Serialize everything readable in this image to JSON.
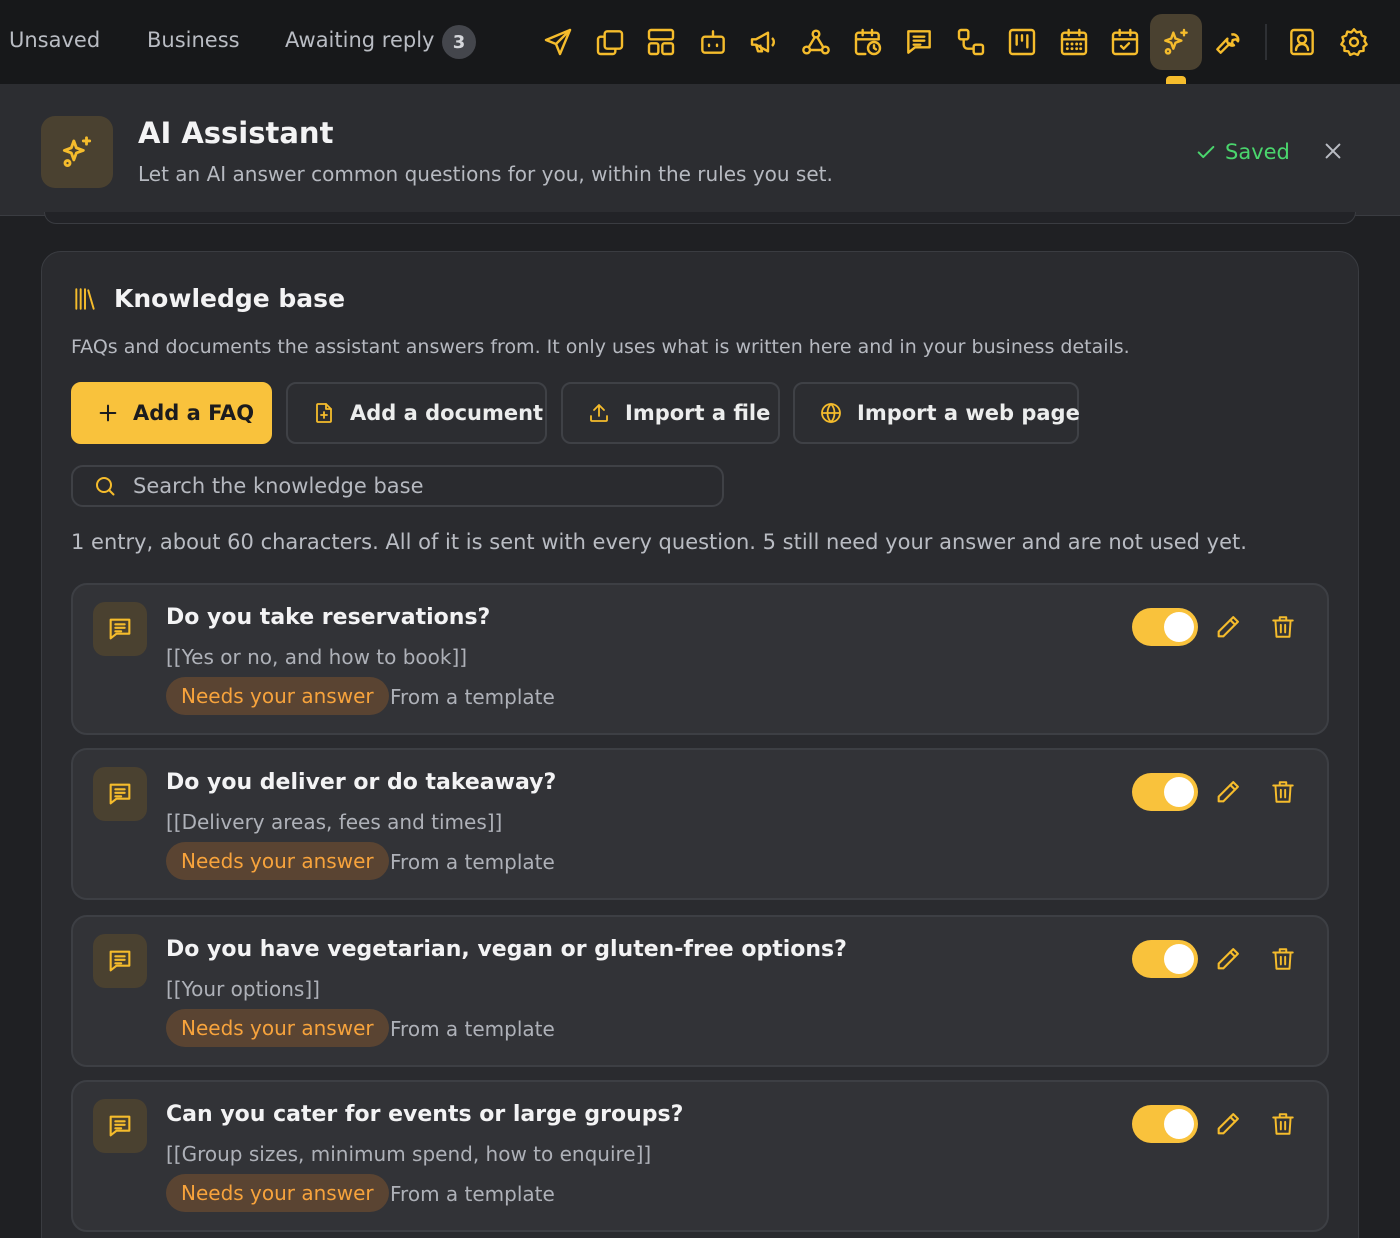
{
  "topbar": {
    "tabs": [
      "Unsaved",
      "Business",
      "Awaiting reply"
    ],
    "awaiting_count": "3",
    "icons": [
      "send-icon",
      "copy-icon",
      "layout-icon",
      "bot-icon",
      "megaphone-icon",
      "webhook-icon",
      "calendar-clock-icon",
      "message-icon",
      "workflow-icon",
      "kanban-icon",
      "calendar-grid-icon",
      "calendar-check-icon",
      "sparkles-icon",
      "wrench-icon",
      "contact-icon",
      "gear-icon"
    ],
    "active_icon": "sparkles-icon"
  },
  "header": {
    "title": "AI Assistant",
    "subtitle": "Let an AI answer common questions for you, within the rules you set.",
    "saved_label": "Saved"
  },
  "knowledge_base": {
    "title": "Knowledge base",
    "description": "FAQs and documents the assistant answers from. It only uses what is written here and in your business details.",
    "buttons": {
      "add_faq": "Add a FAQ",
      "add_document": "Add a document",
      "import_file": "Import a file",
      "import_web": "Import a web page"
    },
    "search_placeholder": "Search the knowledge base",
    "summary": "1 entry, about 60 characters. All of it is sent with every question. 5 still need your answer and are not used yet.",
    "entries": [
      {
        "question": "Do you take reservations?",
        "answer": "[[Yes or no, and how to book]]",
        "status": "Needs your answer",
        "source": "From a template",
        "enabled": true
      },
      {
        "question": "Do you deliver or do takeaway?",
        "answer": "[[Delivery areas, fees and times]]",
        "status": "Needs your answer",
        "source": "From a template",
        "enabled": true
      },
      {
        "question": "Do you have vegetarian, vegan or gluten-free options?",
        "answer": "[[Your options]]",
        "status": "Needs your answer",
        "source": "From a template",
        "enabled": true
      },
      {
        "question": "Can you cater for events or large groups?",
        "answer": "[[Group sizes, minimum spend, how to enquire]]",
        "status": "Needs your answer",
        "source": "From a template",
        "enabled": true
      }
    ]
  },
  "colors": {
    "accent": "#f9c23c",
    "saved": "#4ad66d",
    "pill_text": "#f7a33c",
    "background": "#1f2023"
  }
}
